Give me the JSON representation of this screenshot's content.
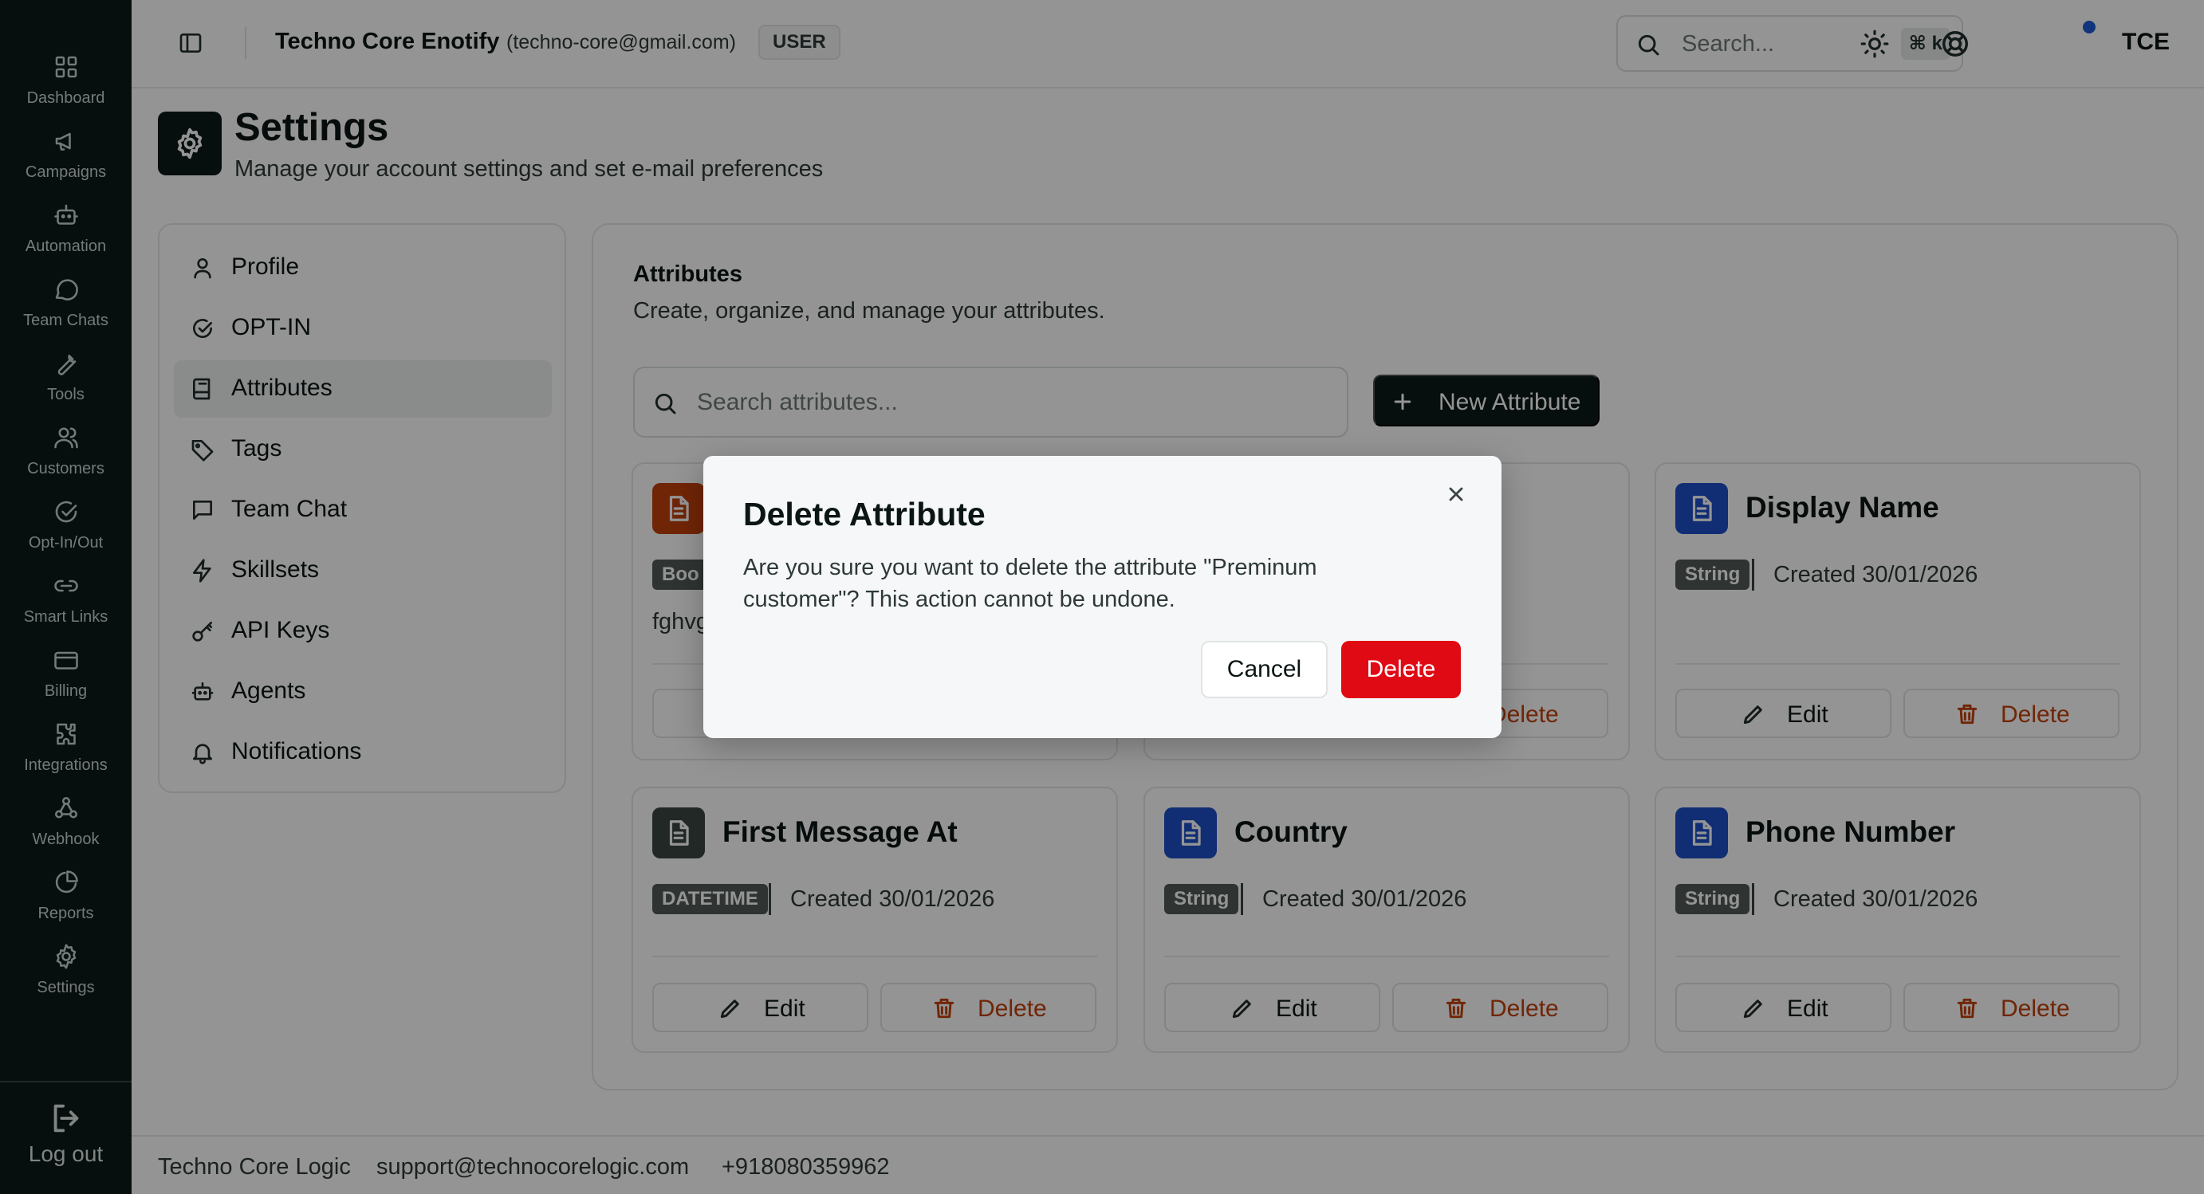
{
  "rail": {
    "items": [
      {
        "label": "Dashboard"
      },
      {
        "label": "Campaigns"
      },
      {
        "label": "Automation"
      },
      {
        "label": "Team Chats"
      },
      {
        "label": "Tools"
      },
      {
        "label": "Customers"
      },
      {
        "label": "Opt-In/Out"
      },
      {
        "label": "Smart Links"
      },
      {
        "label": "Billing"
      },
      {
        "label": "Integrations"
      },
      {
        "label": "Webhook"
      },
      {
        "label": "Reports"
      },
      {
        "label": "Settings"
      }
    ],
    "logout_label": "Log out"
  },
  "topbar": {
    "org_name": "Techno Core Enotify",
    "org_email": "(techno-core@gmail.com)",
    "role": "USER",
    "search_placeholder": "Search...",
    "search_shortcut": "⌘ k",
    "avatar_initials": "TCE"
  },
  "page": {
    "title": "Settings",
    "subtitle": "Manage your account settings and set e-mail preferences"
  },
  "settings_nav": {
    "items": [
      {
        "label": "Profile"
      },
      {
        "label": "OPT-IN"
      },
      {
        "label": "Attributes"
      },
      {
        "label": "Tags"
      },
      {
        "label": "Team Chat"
      },
      {
        "label": "Skillsets"
      },
      {
        "label": "API Keys"
      },
      {
        "label": "Agents"
      },
      {
        "label": "Notifications"
      }
    ],
    "active": "Attributes"
  },
  "attributes": {
    "title": "Attributes",
    "description": "Create, organize, and manage your attributes.",
    "search_placeholder": "Search attributes...",
    "new_button": "New Attribute",
    "edit_label": "Edit",
    "delete_label": "Delete",
    "cards": [
      {
        "name": "",
        "type": "Boo",
        "created": "",
        "description": "fghvg",
        "icon_color": "#c2410c"
      },
      {
        "name": "",
        "type": "",
        "created": "",
        "description": "",
        "icon_color": "#1e50c8"
      },
      {
        "name": "Display Name",
        "type": "String",
        "created": "Created 30/01/2026",
        "description": "",
        "icon_color": "#1e50c8"
      },
      {
        "name": "First Message At",
        "type": "DATETIME",
        "created": "Created 30/01/2026",
        "description": "",
        "icon_color": "#3b4543"
      },
      {
        "name": "Country",
        "type": "String",
        "created": "Created 30/01/2026",
        "description": "",
        "icon_color": "#1e50c8"
      },
      {
        "name": "Phone Number",
        "type": "String",
        "created": "Created 30/01/2026",
        "description": "",
        "icon_color": "#1e50c8"
      }
    ],
    "partial_delete_label": "elete"
  },
  "footer": {
    "company": "Techno Core Logic",
    "email": "support@technocorelogic.com",
    "phone": "+918080359962"
  },
  "modal": {
    "title": "Delete Attribute",
    "body": "Are you sure you want to delete the attribute \"Preminum customer\"? This action cannot be undone.",
    "cancel_label": "Cancel",
    "delete_label": "Delete"
  },
  "colors": {
    "rail_bg": "#0c1a18",
    "danger": "#e00a14",
    "delete_text": "#c2410c",
    "badge_bg": "#525b59"
  }
}
